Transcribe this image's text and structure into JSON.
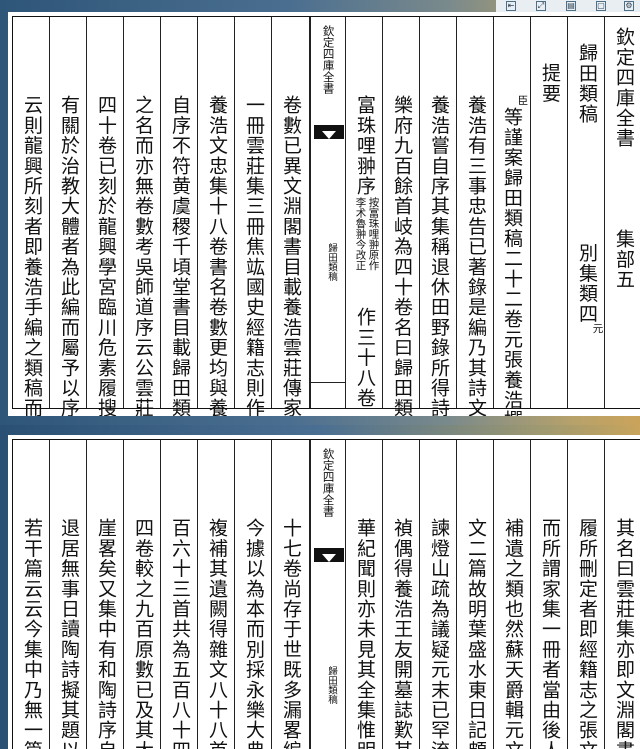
{
  "toolbar": {
    "icons": [
      "first-page-icon",
      "expand-icon",
      "print-icon",
      "copy-icon",
      "settings-icon"
    ]
  },
  "page1": {
    "header_title": "欽定四庫全書",
    "header_section": "集部五",
    "book_title": "歸田類稿",
    "book_category": "別集類四",
    "dynasty": "元",
    "tiyao": "提要",
    "chen": "臣",
    "gutter_title": "欽定四庫全書",
    "gutter_name": "歸田類稿",
    "text_cols": [
      "等謹案歸田類稿二十二卷元張養浩撰",
      "養浩有三事忠告已著錄是編乃其詩文也",
      "養浩嘗自序其集稱退休田野錄所得詩文",
      "樂府九百餘首岐為四十卷名曰歸田類稿",
      "富珠哩翀序",
      "卷數已異文淵閣書目載養浩雲莊傳家集",
      "一冊雲莊集三冊焦竑國史經籍志則作張",
      "養浩文忠集十八卷書名卷數更均與養浩",
      "自序不符黄虞稷千頃堂書目載歸田類稿",
      "之名而亦無卷數考吳師道序云公雲莊集",
      "四十卷已刻於龍興學宮臨川危素履搜其",
      "有關於治教大體者為此編而屬予以序云",
      "云則龍興所刻者即養浩手編之類稿而改"
    ],
    "small_note": "按富珠哩翀原作李术魯翀今改正",
    "small_tail": "作三十八卷"
  },
  "page2": {
    "gutter_title": "欽定四庫全書",
    "gutter_name": "歸田類稿",
    "text_cols": [
      "其名曰雲莊集亦即文淵閣書目",
      "履所刪定者即經籍志之張文忠",
      "而所謂家集一冊者當由後人掇",
      "補遺之類也然蘇天爵輯元文類",
      "文二篇故明葉盛水東日記頗以",
      "諫燈山疏為議疑元末已罕流播",
      "禎偶得養浩王友開墓誌歎其首",
      "華紀聞則亦未見其全集惟明季",
      "十七卷尚存于世既多漏畧編次",
      "今據以為本而別採永樂大典所",
      "複補其遺闕得雜文八十八首詩",
      "百六十三首共為五百八十四首",
      "四卷較之九百原數已及其大半",
      "崖畧矣又集中有和陶詩序自謂",
      "退居無事日讀陶詩擬其題以爲",
      "若干篇云云今集中乃無一篇殆"
    ]
  }
}
